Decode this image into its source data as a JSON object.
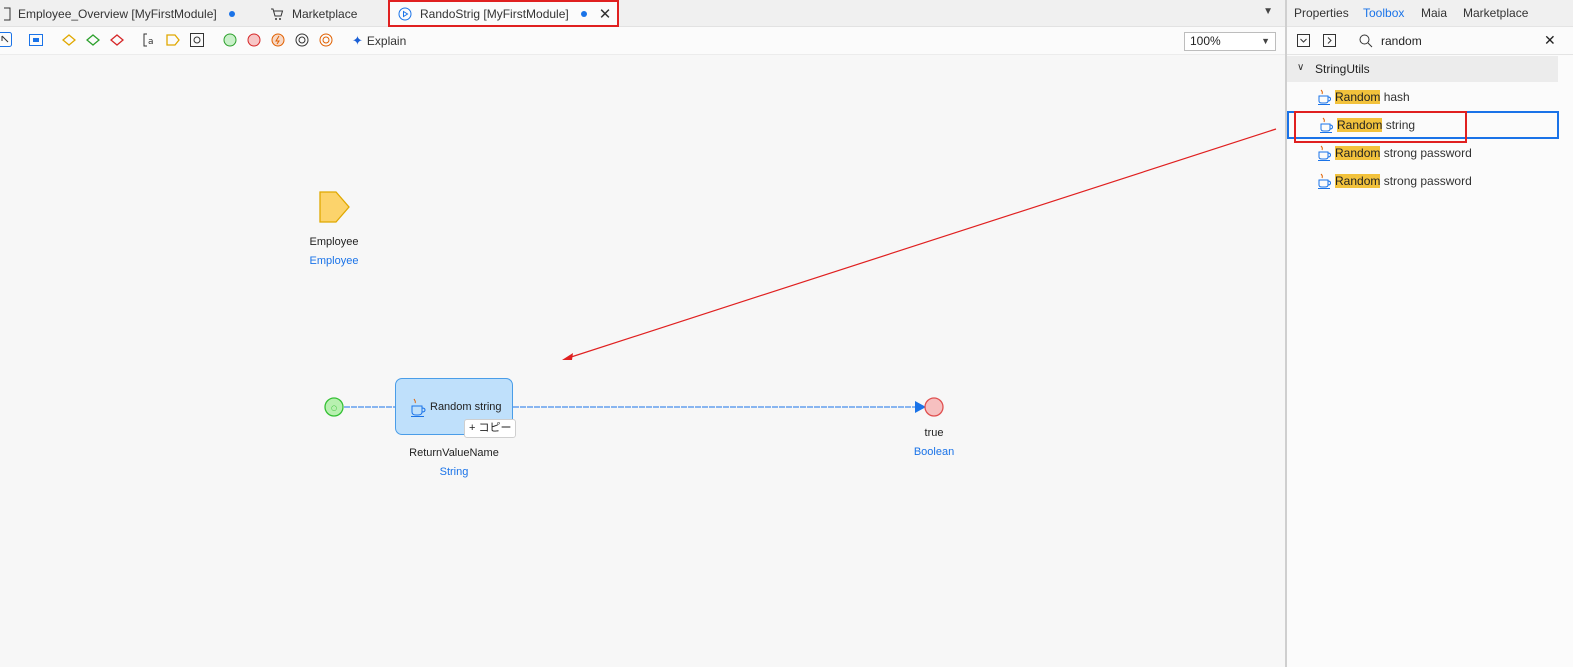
{
  "tabs": [
    {
      "label": "Employee_Overview [MyFirstModule]",
      "unsaved": true,
      "icon": "page-icon"
    },
    {
      "label": "Marketplace",
      "icon": "cart-icon"
    },
    {
      "label": "RandoStrig [MyFirstModule]",
      "unsaved": true,
      "icon": "microflow-icon",
      "active": true
    }
  ],
  "toolbar": {
    "explain_label": "Explain",
    "zoom_value": "100%"
  },
  "canvas": {
    "parameter": {
      "name": "Employee",
      "type": "Employee"
    },
    "activity": {
      "label": "Random string",
      "return_name": "ReturnValueName",
      "return_type": "String",
      "copy_label": "+ コピー"
    },
    "end_event": {
      "value": "true",
      "type": "Boolean"
    }
  },
  "panel": {
    "tabs": [
      "Properties",
      "Toolbox",
      "Maia",
      "Marketplace"
    ],
    "active_tab": "Toolbox",
    "search_value": "random",
    "group": "StringUtils",
    "items": [
      {
        "match": "Random",
        "rest": " hash"
      },
      {
        "match": "Random",
        "rest": " string"
      },
      {
        "match": "Random",
        "rest": " strong password"
      },
      {
        "match": "Random",
        "rest": " strong password"
      }
    ]
  },
  "colors": {
    "accent": "#1a73e8",
    "annotation_red": "#e02020",
    "highlight": "#f2c23c",
    "activity_fill": "#bfe0fb"
  }
}
